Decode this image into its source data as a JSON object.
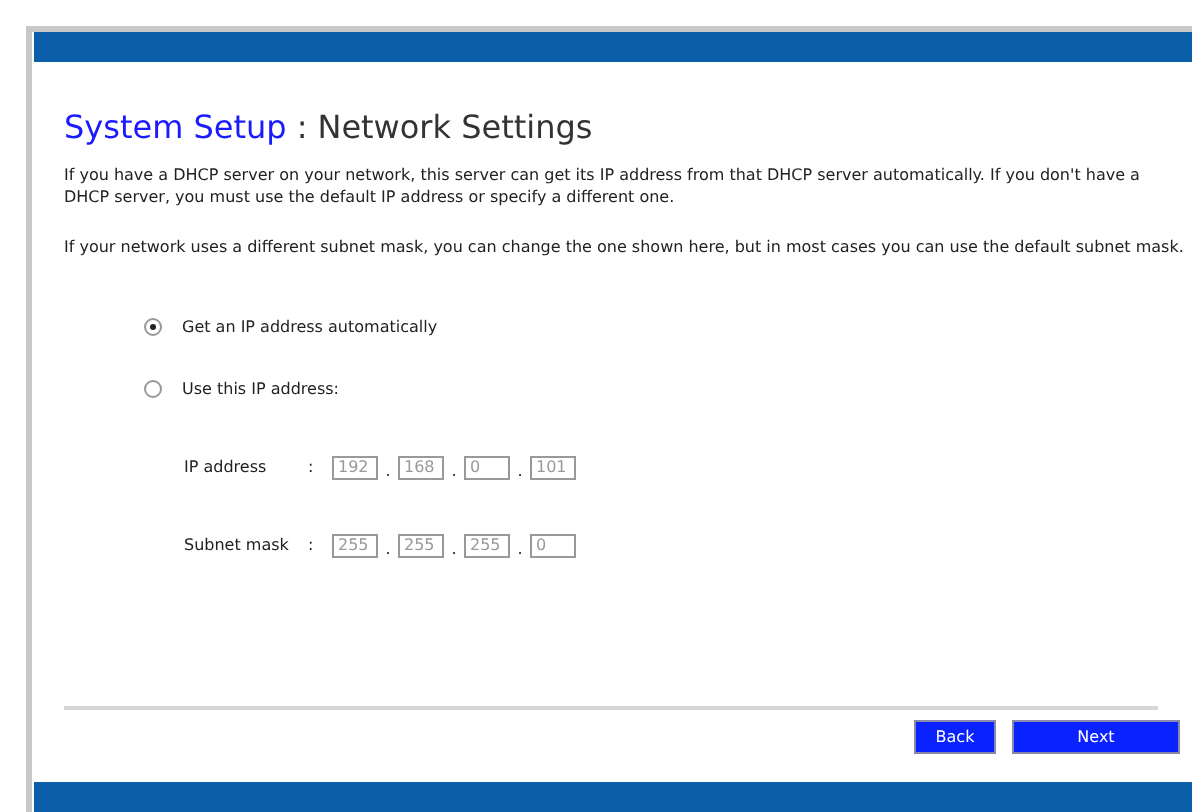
{
  "heading": {
    "section": "System Setup",
    "separator": ":",
    "page": "Network Settings"
  },
  "paragraphs": [
    "If you have a DHCP server on your network, this server can get its IP address from that DHCP server automatically. If you don't have a DHCP server, you must use the default IP address or specify a different one.",
    "If your network uses a different subnet mask, you can change the one shown here, but in most cases you can use the default subnet mask."
  ],
  "options": [
    {
      "label": "Get an IP address automatically",
      "selected": true
    },
    {
      "label": "Use this IP address:",
      "selected": false
    }
  ],
  "address_rows": [
    {
      "label": "IP address",
      "colon": ":",
      "separator": ".",
      "disabled": true,
      "octets": [
        "192",
        "168",
        "0",
        "101"
      ]
    },
    {
      "label": "Subnet mask",
      "colon": ":",
      "separator": ".",
      "disabled": true,
      "octets": [
        "255",
        "255",
        "255",
        "0"
      ]
    }
  ],
  "buttons": [
    "Back",
    "Next"
  ]
}
